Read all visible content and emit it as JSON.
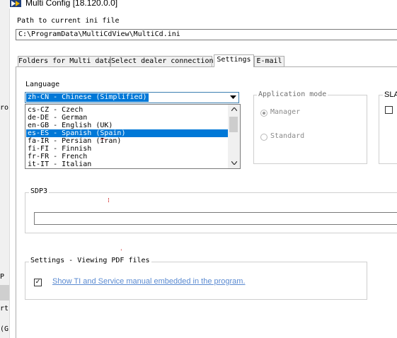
{
  "window": {
    "title": "Multi Config [18.120.0.0]"
  },
  "background_window": {
    "fragments": [
      "ro",
      "P (",
      "rt (",
      "(G"
    ]
  },
  "path": {
    "label": "Path to current ini file",
    "value": "C:\\ProgramData\\MultiCdView\\MultiCd.ini"
  },
  "tabs": [
    {
      "label": "Folders for Multi data",
      "active": false
    },
    {
      "label": "Select dealer connection",
      "active": false
    },
    {
      "label": "Settings",
      "active": true
    },
    {
      "label": "E-mail",
      "active": false
    }
  ],
  "language": {
    "label": "Language",
    "selected": "zh-CN - Chinese (Simplified)",
    "options": [
      {
        "label": "cs-CZ - Czech",
        "highlighted": false
      },
      {
        "label": "de-DE - German",
        "highlighted": false
      },
      {
        "label": "en-GB - English (UK)",
        "highlighted": false
      },
      {
        "label": "es-ES - Spanish (Spain)",
        "highlighted": true
      },
      {
        "label": "fa-IR - Persian (Iran)",
        "highlighted": false
      },
      {
        "label": "fi-FI - Finnish",
        "highlighted": false
      },
      {
        "label": "fr-FR - French",
        "highlighted": false
      },
      {
        "label": "it-IT - Italian",
        "highlighted": false
      }
    ]
  },
  "application_mode": {
    "title": "Application mode",
    "options": [
      {
        "label": "Manager",
        "checked": true,
        "enabled": false
      },
      {
        "label": "Standard",
        "checked": false,
        "enabled": false
      }
    ]
  },
  "sla": {
    "title": "SLA",
    "checked": false
  },
  "sdp3": {
    "title": "SDP3",
    "value": ""
  },
  "pdf": {
    "title": "Settings - Viewing PDF files",
    "checkbox_checked": true,
    "checkbox_glyph": "✓",
    "link_text": "Show TI and Service manual embedded in the program."
  },
  "colors": {
    "selection": "#0078d7",
    "link": "#5a8ad1",
    "panel_border": "#adadad"
  }
}
